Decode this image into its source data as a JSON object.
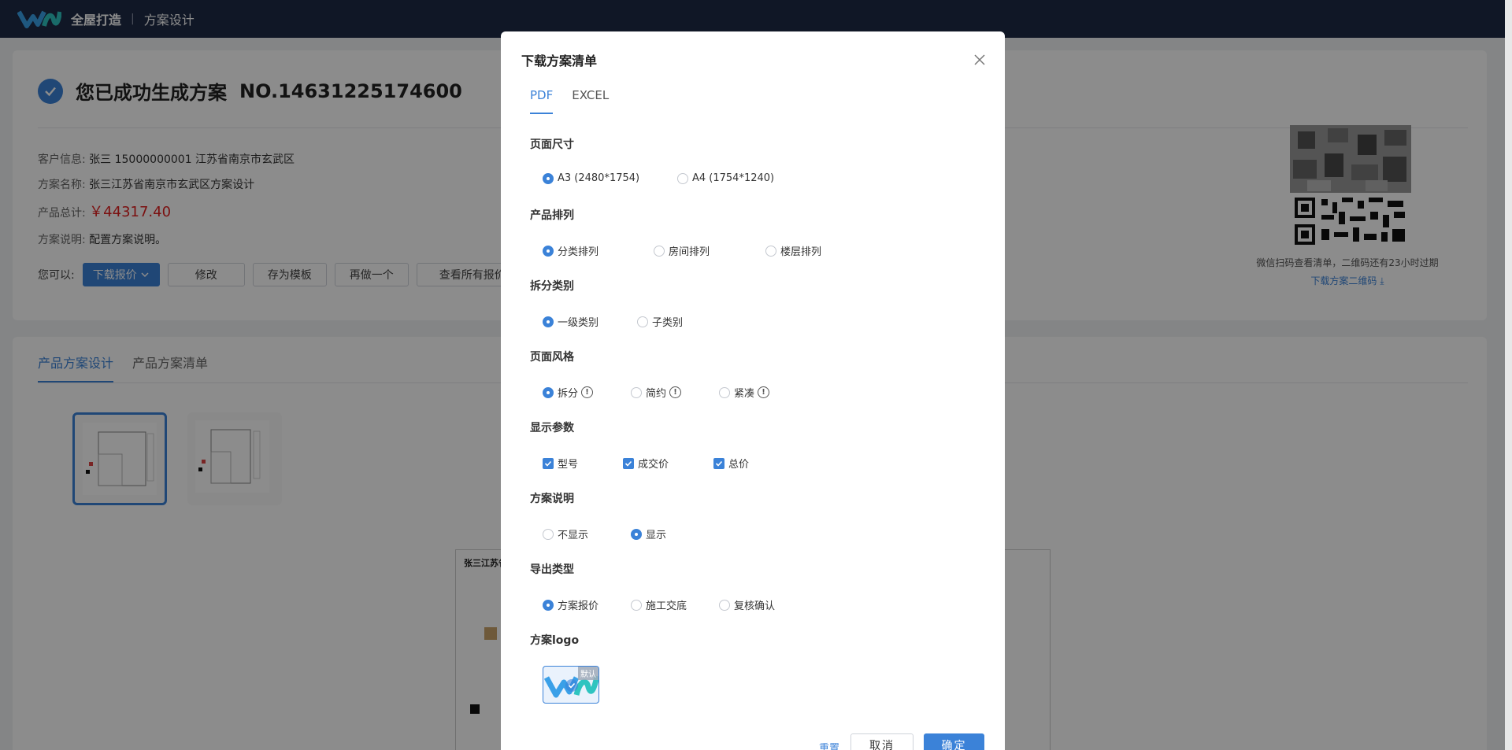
{
  "topbar": {
    "brand": "全屋打造",
    "separator": "|",
    "module": "方案设计"
  },
  "summary": {
    "title": "您已成功生成方案",
    "plan_no": "NO.14631225174600",
    "customer_label": "客户信息:",
    "customer_value": "张三  15000000001  江苏省南京市玄武区",
    "name_label": "方案名称:",
    "name_value": "张三江苏省南京市玄武区方案设计",
    "total_label": "产品总计:",
    "total_value": "￥44317.40",
    "desc_label": "方案说明:",
    "desc_value": "配置方案说明。",
    "actions_label": "您可以:",
    "actions": {
      "download": "下载报价",
      "edit": "修改",
      "save_template": "存为模板",
      "redo": "再做一个",
      "view_all": "查看所有报价"
    }
  },
  "qr": {
    "caption": "微信扫码查看清单，二维码还有23小时过期",
    "link": "下载方案二维码"
  },
  "content_tabs": [
    "产品方案设计",
    "产品方案清单"
  ],
  "preview": {
    "heading": "张三江苏省"
  },
  "modal": {
    "title": "下载方案清单",
    "tabs": [
      "PDF",
      "EXCEL"
    ],
    "sections": {
      "page_size": {
        "title": "页面尺寸",
        "options": [
          "A3 (2480*1754)",
          "A4 (1754*1240)"
        ],
        "selected": 0
      },
      "arrangement": {
        "title": "产品排列",
        "options": [
          "分类排列",
          "房间排列",
          "楼层排列"
        ],
        "selected": 0
      },
      "split": {
        "title": "拆分类别",
        "options": [
          "一级类别",
          "子类别"
        ],
        "selected": 0
      },
      "style": {
        "title": "页面风格",
        "options": [
          "拆分",
          "简约",
          "紧凑"
        ],
        "selected": 0
      },
      "params": {
        "title": "显示参数",
        "options": [
          "型号",
          "成交价",
          "总价"
        ]
      },
      "description": {
        "title": "方案说明",
        "options": [
          "不显示",
          "显示"
        ],
        "selected": 1
      },
      "export": {
        "title": "导出类型",
        "options": [
          "方案报价",
          "施工交底",
          "复核确认"
        ],
        "selected": 0
      },
      "logo": {
        "title": "方案logo",
        "badge": "默认"
      }
    },
    "footer": {
      "reset": "重置",
      "cancel": "取消",
      "confirm": "确定"
    }
  },
  "colors": {
    "accent": "#3b82d8",
    "topbar": "#1e2b45",
    "price": "#e02020"
  }
}
